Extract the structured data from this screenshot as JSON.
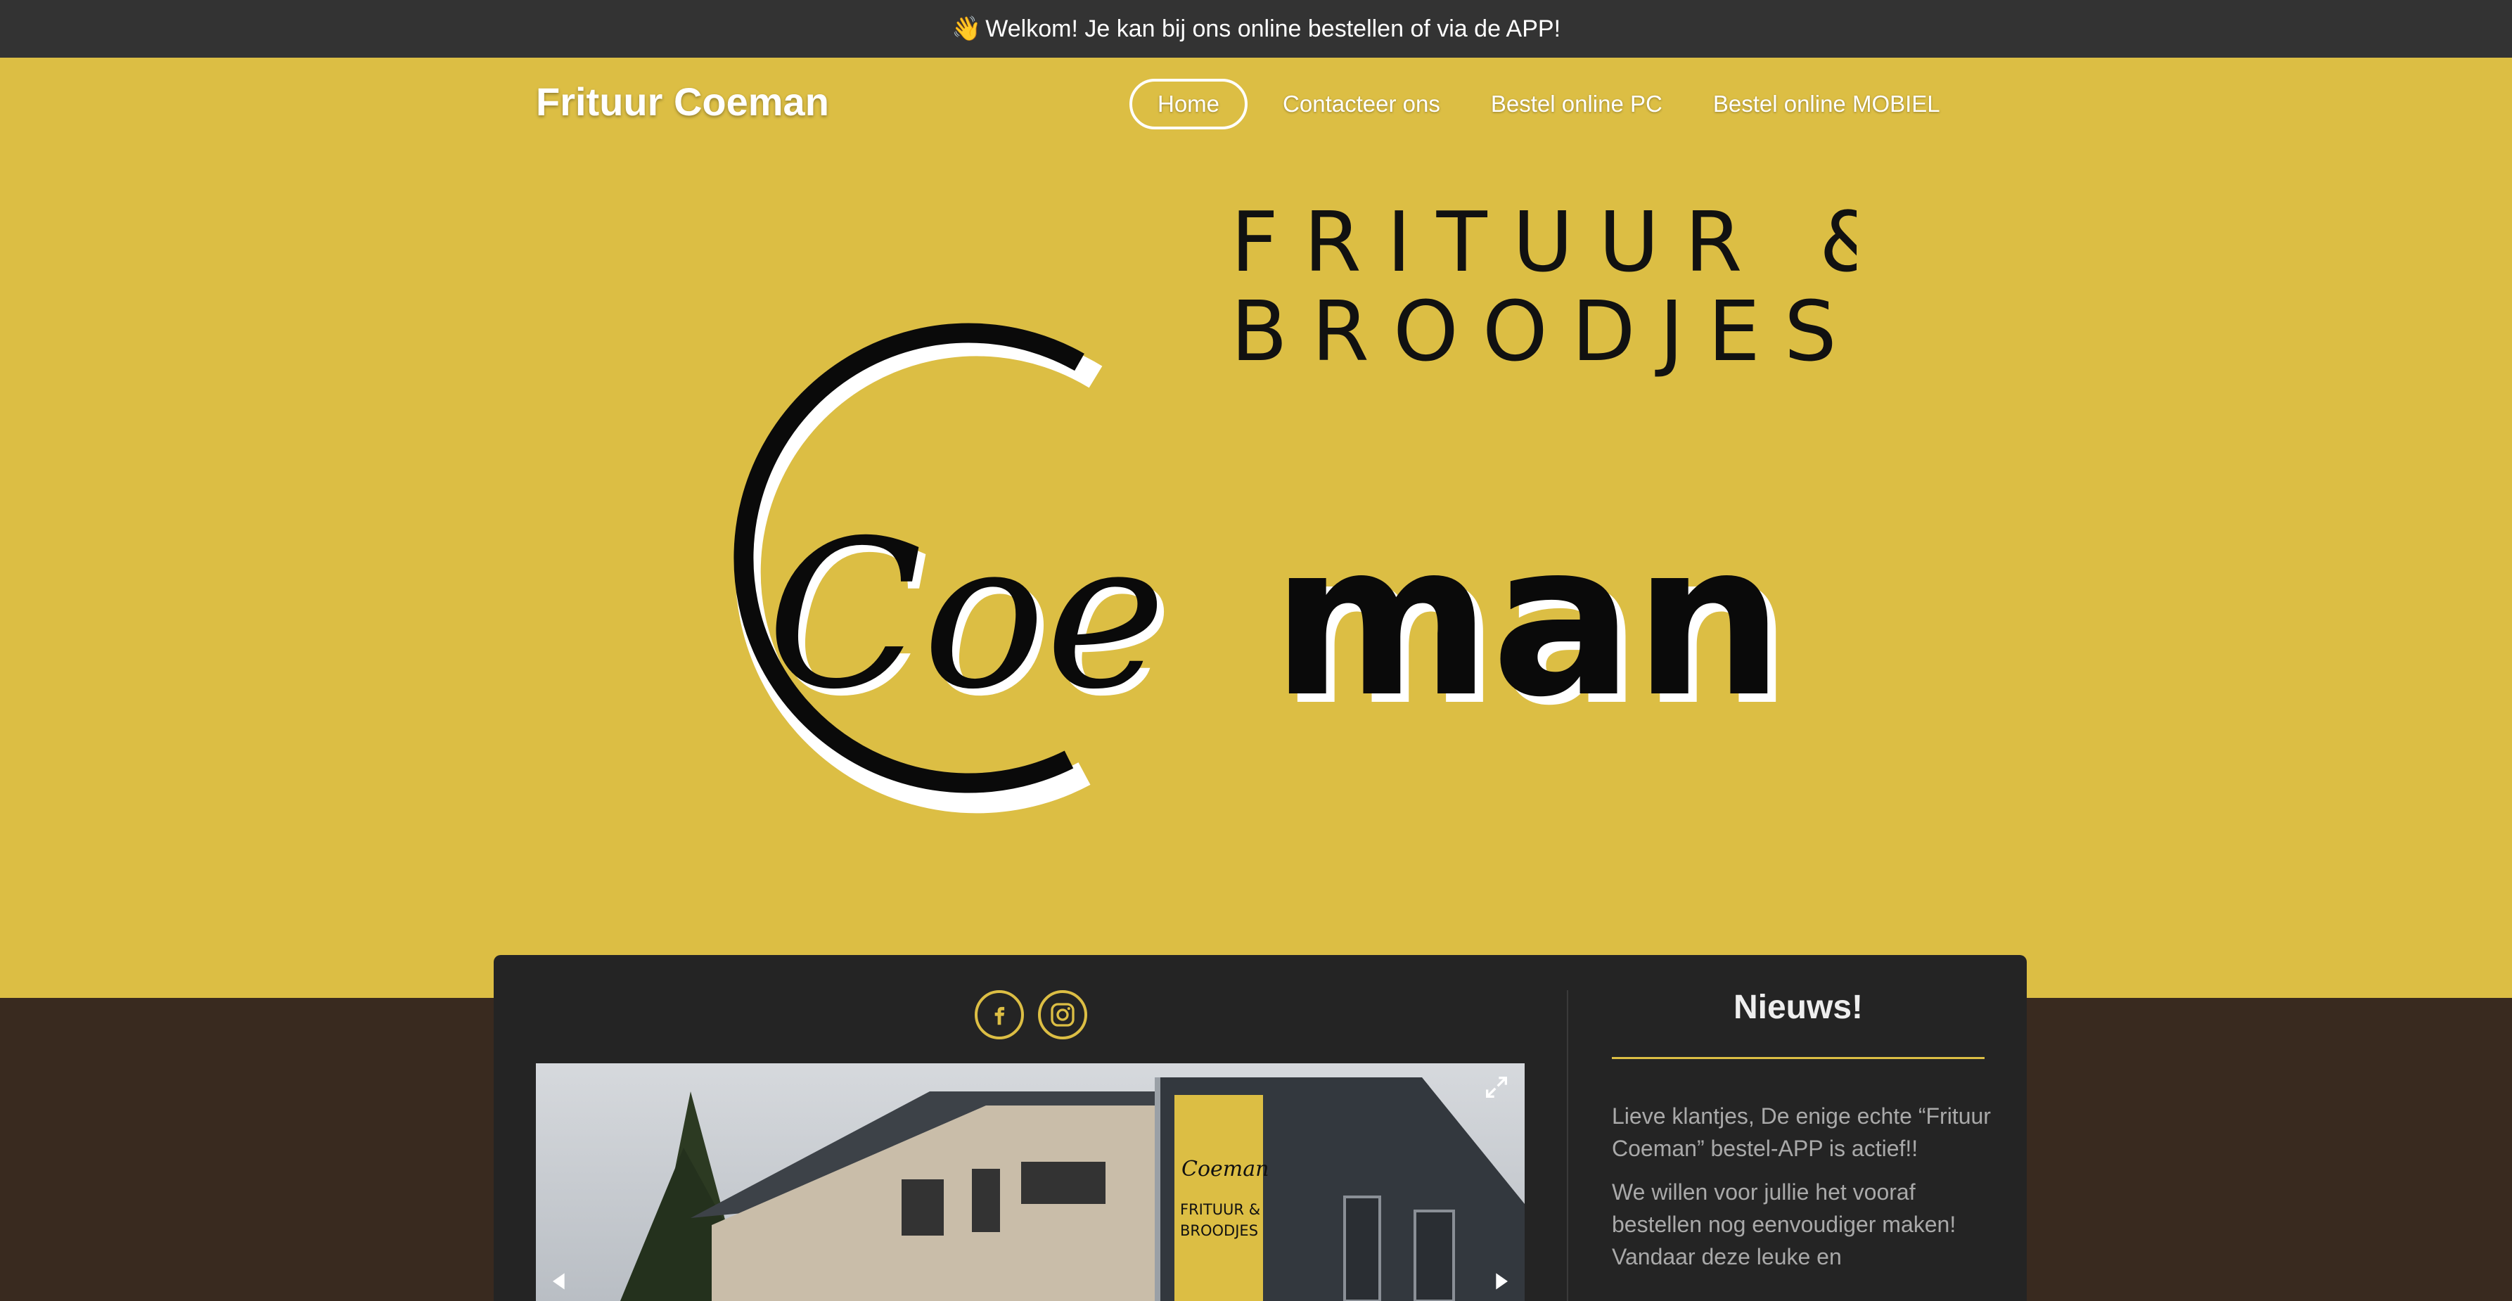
{
  "announcement": {
    "emoji": "👋",
    "text": "Welkom! Je kan bij ons online bestellen of via de APP!"
  },
  "site": {
    "title": "Frituur Coeman"
  },
  "nav": {
    "items": [
      {
        "label": "Home",
        "active": true
      },
      {
        "label": "Contacteer ons",
        "active": false
      },
      {
        "label": "Bestel online PC",
        "active": false
      },
      {
        "label": "Bestel online MOBIEL",
        "active": false
      }
    ]
  },
  "logo": {
    "line1": "FRITUUR &",
    "line2": "BROODJES",
    "wordmark_script": "Coe",
    "wordmark_bold": "man"
  },
  "social": [
    {
      "icon": "facebook-icon"
    },
    {
      "icon": "instagram-icon"
    }
  ],
  "gallery": {
    "sign_text_1": "Coeman",
    "sign_text_2": "FRITUUR &",
    "sign_text_3": "BROODJES"
  },
  "news": {
    "title": "Nieuws!",
    "paragraphs": [
      "Lieve klantjes, De enige echte “Frituur Coeman” bestel-APP is actief!!",
      "We willen voor jullie het vooraf bestellen nog eenvoudiger maken! Vandaar deze leuke en"
    ]
  },
  "colors": {
    "brand_yellow": "#dcbe44",
    "dark": "#242424",
    "topbar": "#333333",
    "brown": "#392a1f"
  }
}
